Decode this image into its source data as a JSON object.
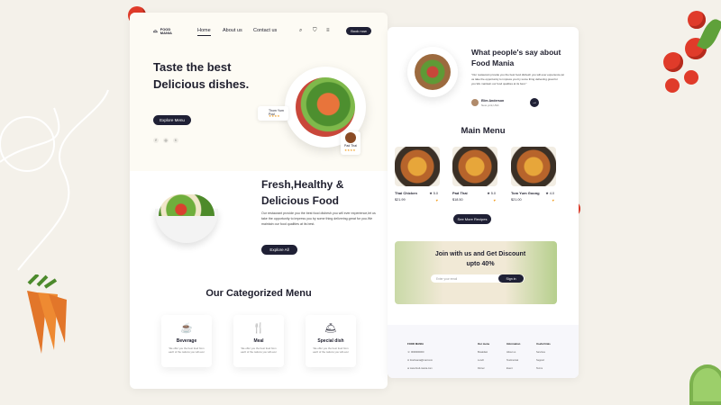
{
  "nav": {
    "logo_line1": "FOOD",
    "logo_line2": "MANIA",
    "links": [
      "Home",
      "About us",
      "Contact us"
    ],
    "book_label": "Book now"
  },
  "hero": {
    "title": "Taste the best Delicious dishes.",
    "explore_label": "Explore Menu",
    "tag1_name": "Thom Yum Poul",
    "tag2_name": "Pad Thai",
    "stars": "★★★★",
    "social": [
      "f",
      "◎",
      "t"
    ]
  },
  "fresh": {
    "title": "Fresh,Healthy & Delicious Food",
    "paragraph": "Our restaurant provide you the best food dishesh you will ever experience,let us take the opportunity to impress you by some thing delivering great for you.We maintain our food qualities at its best.",
    "button": "Explore All"
  },
  "categories": {
    "title": "Our Categorized Menu",
    "items": [
      {
        "icon": "☕",
        "name": "Beverage",
        "desc": "We offer you the best food from each of the nations you will ever"
      },
      {
        "icon": "🍴",
        "name": "Meal",
        "desc": "We offer you the best food from each of the nations you will ever"
      },
      {
        "icon": "🛎",
        "name": "Special dish",
        "desc": "We offer you the best food from each of the nations you will ever"
      }
    ]
  },
  "testimonial": {
    "title": "What people's say about Food Mania",
    "quote": "\"Our restaurant provide you the best food dishesh you will ever experience,let us take the opportunity to impress you by some thing delivering great for you.We maintain our food qualities at its best.\"",
    "author": "Elim Anderson",
    "author_role": "New york,USA",
    "arrow": "→"
  },
  "main_menu": {
    "title": "Main Menu",
    "items": [
      {
        "name": "Thai Chicken",
        "rating": "★ 5.0",
        "price": "$21.99"
      },
      {
        "name": "Pad Thai",
        "rating": "★ 5.0",
        "price": "$18.50"
      },
      {
        "name": "Tom Yum Goong",
        "rating": "★ 4.0",
        "price": "$21.00"
      }
    ],
    "see_more": "See More Recipes"
  },
  "promo": {
    "title": "Join with us and Get Discount upto 40%",
    "email_placeholder": "Enter your email",
    "signin": "Sign in"
  },
  "footer": {
    "logo": "FOOD MANIA",
    "phone": "☏ 0000000000",
    "email": "✉ foodmania@mail.com",
    "web": "⊕ www.food-mania.com",
    "col1": {
      "title": "Our menu",
      "links": [
        "Breakfast",
        "Lunch",
        "Dinner"
      ]
    },
    "col2": {
      "title": "Information",
      "links": [
        "About us",
        "Testimonial",
        "Event"
      ]
    },
    "col3": {
      "title": "Useful links",
      "links": [
        "Services",
        "Support",
        "Terms"
      ]
    }
  }
}
